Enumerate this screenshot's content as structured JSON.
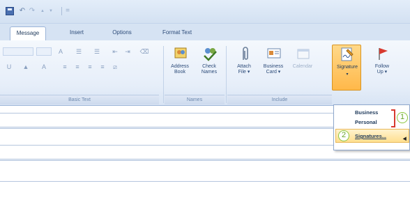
{
  "qat": {
    "items": [
      "save-icon",
      "undo-icon",
      "redo-icon",
      "up-icon",
      "down-icon",
      "customize-icon"
    ],
    "undo_glyph": "↶",
    "redo_glyph": "↷",
    "up_glyph": "▲",
    "down_glyph": "▼",
    "customize_glyph": "="
  },
  "tabs": [
    {
      "label": "Message",
      "active": true
    },
    {
      "label": "Insert",
      "active": false
    },
    {
      "label": "Options",
      "active": false
    },
    {
      "label": "Format Text",
      "active": false
    }
  ],
  "ribbon": {
    "groups": {
      "basic_text": "Basic Text",
      "names": "Names",
      "include": "Include"
    },
    "buttons": {
      "address_book": "Address\nBook",
      "check_names": "Check\nNames",
      "attach_file": "Attach\nFile ▾",
      "business_card": "Business\nCard ▾",
      "calendar": "Calendar",
      "signature": "Signature",
      "signature_arrow": "▾",
      "follow_up": "Follow\nUp ▾"
    }
  },
  "dropdown": {
    "items": [
      "Business",
      "Personal"
    ],
    "signatures_label": "Signatures...",
    "callout_1": "1",
    "callout_2": "2"
  },
  "colors": {
    "accent_gold": "#ffb84a",
    "flag_red": "#d73a2f",
    "callout_green": "#8cc63e"
  }
}
